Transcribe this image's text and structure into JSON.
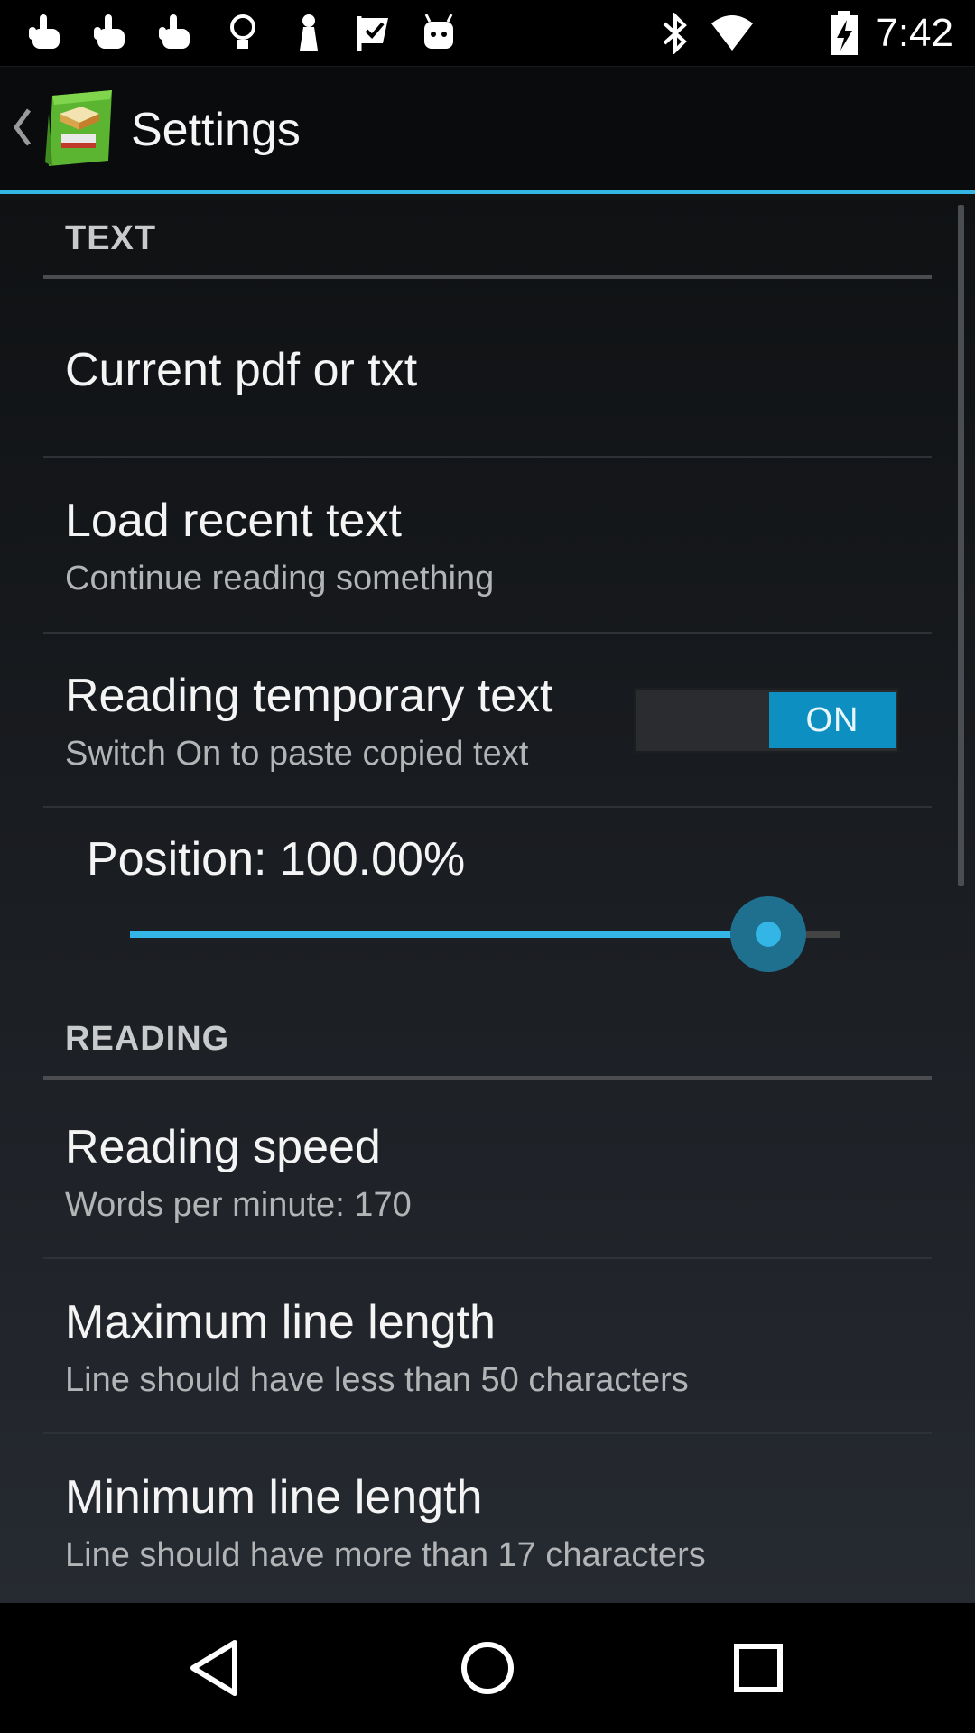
{
  "status_bar": {
    "time": "7:42",
    "left_icons": [
      "notification-hand-icon",
      "notification-hand-icon",
      "notification-hand-icon",
      "lightbulb-icon",
      "pawn-icon",
      "flag-check-icon",
      "android-icon"
    ],
    "right_icons": [
      "bluetooth-icon",
      "wifi-icon",
      "battery-charging-icon"
    ]
  },
  "action_bar": {
    "title": "Settings"
  },
  "categories": {
    "text": {
      "label": "TEXT"
    },
    "reading": {
      "label": "READING"
    }
  },
  "prefs": {
    "current": {
      "title": "Current pdf or txt"
    },
    "load_recent": {
      "title": "Load recent text",
      "summary": "Continue reading something"
    },
    "temporary": {
      "title": "Reading temporary text",
      "summary": "Switch On to paste copied text",
      "toggle_label": "ON",
      "toggle_on": true
    },
    "position": {
      "label": "Position: 100.00%",
      "value": 1.0
    },
    "speed": {
      "title": "Reading speed",
      "summary": "Words per minute: 170"
    },
    "max_line": {
      "title": "Maximum line length",
      "summary": "Line should have less than 50 characters"
    },
    "min_line": {
      "title": "Minimum line length",
      "summary": "Line should have more than 17 characters"
    }
  },
  "nav_bar": {
    "icons": [
      "back-icon",
      "home-icon",
      "recents-icon"
    ]
  },
  "colors": {
    "accent": "#33b5e5",
    "toggle_on": "#0e8fc1"
  }
}
